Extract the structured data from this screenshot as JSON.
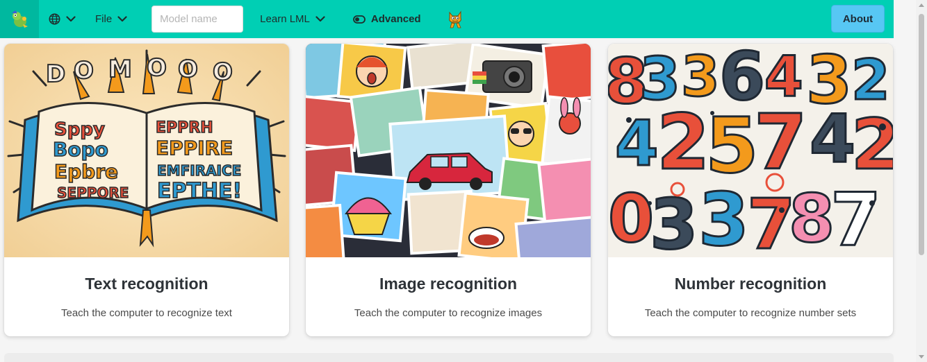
{
  "colors": {
    "navbar": "#00cfb4",
    "navbar_logo_bg": "#00b89f",
    "about_button": "#57c7f4",
    "page_bg": "#f5f5f5"
  },
  "navbar": {
    "logo_icon": "lml-logo-icon",
    "language_icon": "globe-icon",
    "file_label": "File",
    "model_name_placeholder": "Model name",
    "learn_label": "Learn LML",
    "advanced_label": "Advanced",
    "advanced_icon": "toggle-off-icon",
    "scratch_icon": "scratch-cat-icon",
    "about_label": "About"
  },
  "cards": [
    {
      "title": "Text recognition",
      "description": "Teach the computer to recognize text",
      "image_icon": "open-book-letters-illustration"
    },
    {
      "title": "Image recognition",
      "description": "Teach the computer to recognize images",
      "image_icon": "photo-collage-illustration"
    },
    {
      "title": "Number recognition",
      "description": "Teach the computer to recognize number sets",
      "image_icon": "colorful-numbers-illustration"
    }
  ]
}
